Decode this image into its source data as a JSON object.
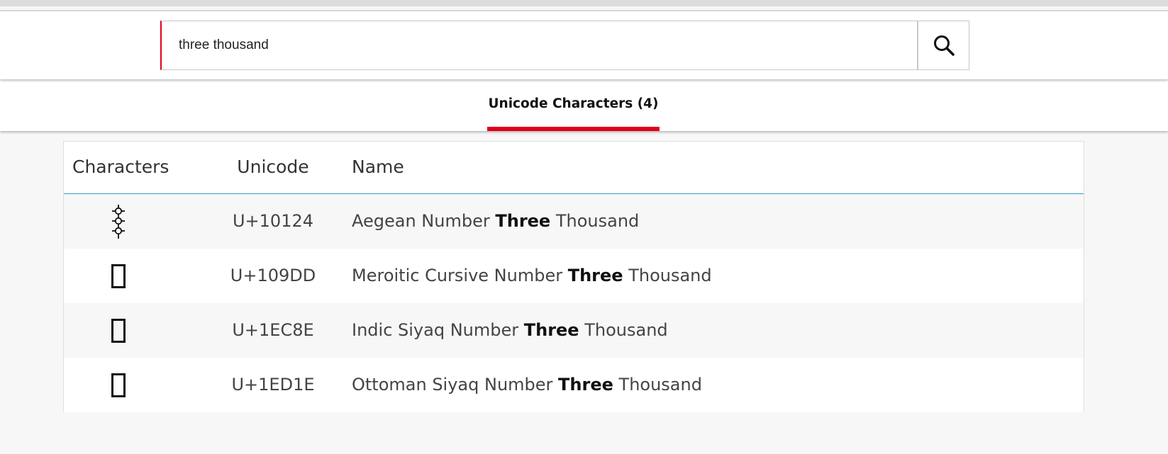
{
  "search": {
    "value": "three thousand",
    "button_icon": "search-icon"
  },
  "tabs": [
    {
      "label": "Unicode Characters (4)",
      "active": true
    }
  ],
  "table": {
    "headers": {
      "characters": "Characters",
      "unicode": "Unicode",
      "name": "Name"
    },
    "rows": [
      {
        "glyph": "aegean-number-three-thousand-glyph",
        "unicode": "U+10124",
        "name_before": "Aegean Number ",
        "name_match": "Three",
        "name_after": " Thousand"
      },
      {
        "glyph": "missing-glyph-box",
        "unicode": "U+109DD",
        "name_before": "Meroitic Cursive Number ",
        "name_match": "Three",
        "name_after": " Thousand"
      },
      {
        "glyph": "missing-glyph-box",
        "unicode": "U+1EC8E",
        "name_before": "Indic Siyaq Number ",
        "name_match": "Three",
        "name_after": " Thousand"
      },
      {
        "glyph": "missing-glyph-box",
        "unicode": "U+1ED1E",
        "name_before": "Ottoman Siyaq Number ",
        "name_match": "Three",
        "name_after": " Thousand"
      }
    ]
  },
  "colors": {
    "accent": "#e0001b",
    "header_divider": "#29a3c9",
    "page_background": "#f7f7f7"
  }
}
